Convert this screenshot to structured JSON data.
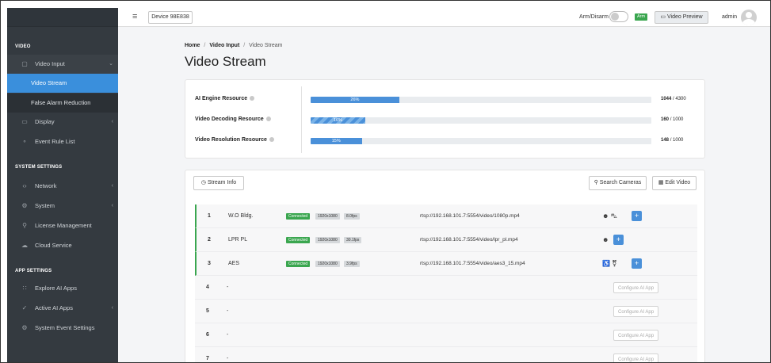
{
  "topbar": {
    "device": "Device 98E838",
    "arm_label": "Arm/Disarm",
    "arm_badge": "Arm",
    "preview": "Video Preview",
    "user": "admin"
  },
  "sidebar": {
    "sections": [
      {
        "title": "VIDEO"
      },
      {
        "title": "SYSTEM SETTINGS"
      },
      {
        "title": "APP SETTINGS"
      }
    ],
    "items": [
      {
        "label": "Video Input",
        "icon": "camera-icon"
      },
      {
        "label": "Video Stream"
      },
      {
        "label": "False Alarm Reduction"
      },
      {
        "label": "Display",
        "icon": "monitor-icon"
      },
      {
        "label": "Event Rule List",
        "icon": "rule-icon"
      },
      {
        "label": "Network",
        "icon": "network-icon"
      },
      {
        "label": "System",
        "icon": "gear-icon"
      },
      {
        "label": "License Management",
        "icon": "key-icon"
      },
      {
        "label": "Cloud Service",
        "icon": "cloud-icon"
      },
      {
        "label": "Explore AI Apps",
        "icon": "grid-icon"
      },
      {
        "label": "Active AI Apps",
        "icon": "check-icon"
      },
      {
        "label": "System Event Settings",
        "icon": "gear-icon"
      }
    ]
  },
  "breadcrumb": {
    "home": "Home",
    "sep": "/",
    "parent": "Video Input",
    "current": "Video Stream"
  },
  "page_title": "Video Stream",
  "resources": [
    {
      "label": "AI Engine Resource",
      "percent_text": "26%",
      "percent": 26,
      "value": "1044",
      "total": "/ 4300",
      "striped": false
    },
    {
      "label": "Video Decoding Resource",
      "percent_text": "16%",
      "percent": 16,
      "value": "160",
      "total": "/ 1000",
      "striped": true
    },
    {
      "label": "Video Resolution Resource",
      "percent_text": "15%",
      "percent": 15,
      "value": "148",
      "total": "/ 1000",
      "striped": false
    }
  ],
  "toolbar": {
    "stream_info": "Stream Info",
    "search_cameras": "Search Cameras",
    "edit_video": "Edit Video"
  },
  "streams": [
    {
      "num": "1",
      "name": "W.O Bldg.",
      "status": "Connected",
      "res": "1920x1080",
      "fps": "8.0fps",
      "url": "rtsp://192.168.101.7:5554/video/1080p.mp4",
      "apps": "☻ ⛍"
    },
    {
      "num": "2",
      "name": "LPR PL",
      "status": "Connected",
      "res": "1920x1080",
      "fps": "30.1fps",
      "url": "rtsp://192.168.101.7:5554/video/lpr_pl.mp4",
      "apps": "☻"
    },
    {
      "num": "3",
      "name": "AES",
      "status": "Connected",
      "res": "1920x1080",
      "fps": "3.9fps",
      "url": "rtsp://192.168.101.7:5554/video/aes3_15.mp4",
      "apps": "♿ ⚧"
    },
    {
      "num": "4",
      "name": "-",
      "configure": "Configure AI App"
    },
    {
      "num": "5",
      "name": "-",
      "configure": "Configure AI App"
    },
    {
      "num": "6",
      "name": "-",
      "configure": "Configure AI App"
    },
    {
      "num": "7",
      "name": "-",
      "configure": "Configure AI App"
    }
  ],
  "colors": {
    "accent": "#3a8fdc",
    "sidebar": "#343a40",
    "connected": "#3aa64f"
  }
}
